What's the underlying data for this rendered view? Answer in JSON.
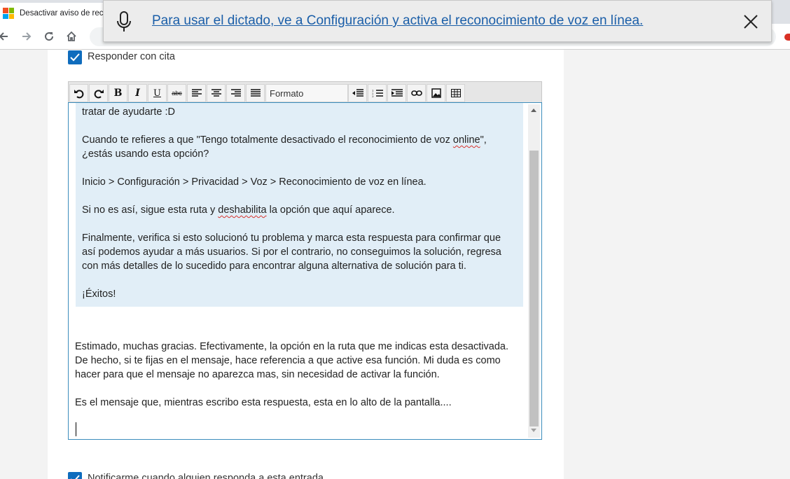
{
  "browser": {
    "tab_title": "Desactivar aviso de rec",
    "logo_colors": [
      "#f25022",
      "#7fba00",
      "#00a4ef",
      "#ffb900"
    ]
  },
  "dictation": {
    "message": "Para usar el dictado, ve a Configuración y activa el reconocimiento de voz en línea."
  },
  "form": {
    "reply_with_quote_label": "Responder con cita",
    "reply_with_quote_checked": true,
    "notify_label": "Notificarme cuando alguien responda a esta entrada",
    "notify_checked": true
  },
  "editor_toolbar": {
    "bold_label": "B",
    "italic_label": "I",
    "underline_label": "U",
    "strike_label": "abc",
    "format_select": "Formato"
  },
  "editor": {
    "quote_lines": {
      "l1": "tratar de ayudarte :D",
      "l2a": "Cuando te refieres a que \"Tengo totalmente desactivado el reconocimiento de voz ",
      "l2b": "online",
      "l2c": "\",",
      "l3": "¿estás usando esta opción?",
      "l4": "Inicio > Configuración  > Privacidad  > Voz > Reconocimiento de voz en línea.",
      "l5a": "Si no es así, sigue esta ruta y ",
      "l5b": "deshabilita",
      "l5c": " la opción que aquí aparece.",
      "l6": "Finalmente, verifica si esto solucionó tu problema y marca esta respuesta para confirmar que",
      "l7": "así podemos ayudar a más usuarios. Si por el contrario, no conseguimos la solución, regresa",
      "l8": "con más detalles de lo sucedido para encontrar alguna alternativa de solución para ti.",
      "l9": "¡Éxitos!"
    },
    "reply_lines": {
      "r1": "Estimado, muchas gracias. Efectivamente, la opción en la ruta que me indicas esta desactivada.",
      "r2": "De hecho, si te fijas en el mensaje, hace referencia a que active esa función. Mi duda es como",
      "r3": "hacer para que el mensaje no aparezca mas, sin necesidad de activar la función.",
      "r4": "Es el mensaje que, mientras escribo esta respuesta, esta en lo alto de la pantalla...."
    }
  }
}
